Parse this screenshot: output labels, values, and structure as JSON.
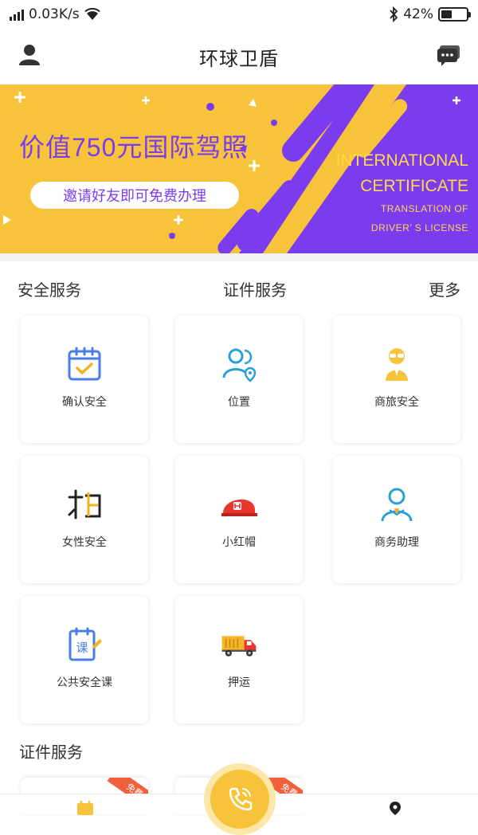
{
  "status_bar": {
    "network_speed": "0.03K/s",
    "battery_percent": "42%",
    "battery_level": 0.42,
    "icons": [
      "signal-icon",
      "wifi-icon",
      "bluetooth-icon",
      "battery-icon"
    ]
  },
  "nav": {
    "title": "环球卫盾",
    "left_icon": "user-icon",
    "right_icon": "message-icon"
  },
  "banner": {
    "headline": "价值750元国际驾照",
    "pill_text": "邀请好友即可免费办理",
    "en_line1": "INTERNATIONAL",
    "en_line2": "CERTIFICATE",
    "en_line3": "TRANSLATION OF",
    "en_line4": "DRIVER’ S LICENSE",
    "colors": {
      "yellow": "#f7c33a",
      "purple": "#7b3cf0"
    }
  },
  "tabs": {
    "safety": "安全服务",
    "certificates": "证件服务",
    "more": "更多"
  },
  "services": [
    {
      "label": "确认安全",
      "icon": "calendar-check-icon"
    },
    {
      "label": "位置",
      "icon": "user-location-icon"
    },
    {
      "label": "商旅安全",
      "icon": "traveler-icon"
    },
    {
      "label": "女性安全",
      "icon": "female-safety-icon"
    },
    {
      "label": "小红帽",
      "icon": "red-cap-icon"
    },
    {
      "label": "商务助理",
      "icon": "business-assistant-icon"
    },
    {
      "label": "公共安全课",
      "icon": "course-icon"
    },
    {
      "label": "押运",
      "icon": "truck-icon"
    }
  ],
  "cert_section": {
    "title": "证件服务",
    "ribbon_text": "免费"
  },
  "tabbar": {
    "icons": [
      "calendar-tab-icon",
      "phone-call-icon",
      "location-tab-icon"
    ]
  }
}
